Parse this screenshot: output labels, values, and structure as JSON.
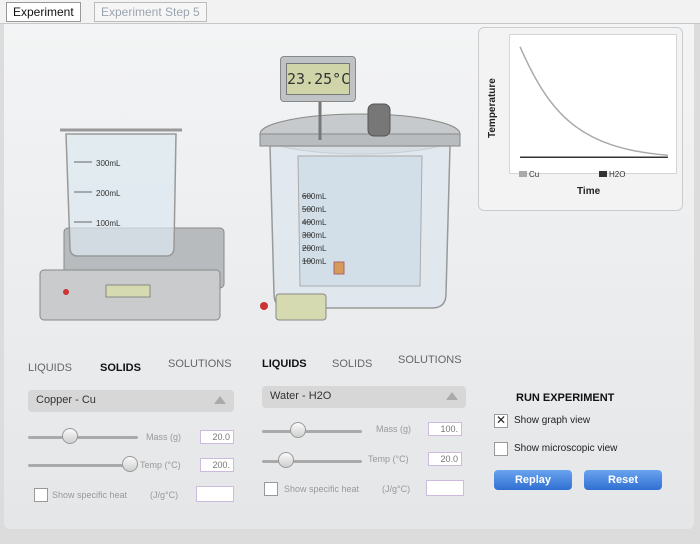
{
  "tabs": {
    "experiment": "Experiment",
    "step": "Experiment Step 5"
  },
  "readout": {
    "temperature": "23.25°C"
  },
  "beaker": {
    "marks": [
      "300mL",
      "200mL",
      "100mL"
    ]
  },
  "calorimeter": {
    "marks": [
      "600mL",
      "500mL",
      "400mL",
      "300mL",
      "200mL",
      "100mL"
    ]
  },
  "graph": {
    "ylabel": "Temperature",
    "xlabel": "Time",
    "legend": [
      "Cu",
      "H2O"
    ],
    "colors": {
      "cu": "#aaaaaa",
      "h2o": "#333333"
    }
  },
  "left_panel": {
    "tabs": [
      "LIQUIDS",
      "SOLIDS",
      "SOLUTIONS"
    ],
    "active_tab": "SOLIDS",
    "dropdown": "Copper - Cu",
    "mass_label": "Mass (g)",
    "mass_value": "20.0",
    "temp_label": "Temp (°C)",
    "temp_value": "200.",
    "specific_heat_label": "Show specific heat",
    "specific_heat_unit": "(J/g°C)"
  },
  "right_panel": {
    "tabs": [
      "LIQUIDS",
      "SOLIDS",
      "SOLUTIONS"
    ],
    "active_tab": "LIQUIDS",
    "dropdown": "Water - H2O",
    "mass_label": "Mass (g)",
    "mass_value": "100.",
    "temp_label": "Temp (°C)",
    "temp_value": "20.0",
    "specific_heat_label": "Show specific heat",
    "specific_heat_unit": "(J/g°C)"
  },
  "run": {
    "title": "RUN EXPERIMENT",
    "show_graph": "Show graph view",
    "show_graph_checked": true,
    "show_micro": "Show microscopic view",
    "show_micro_checked": false,
    "replay": "Replay",
    "reset": "Reset"
  }
}
